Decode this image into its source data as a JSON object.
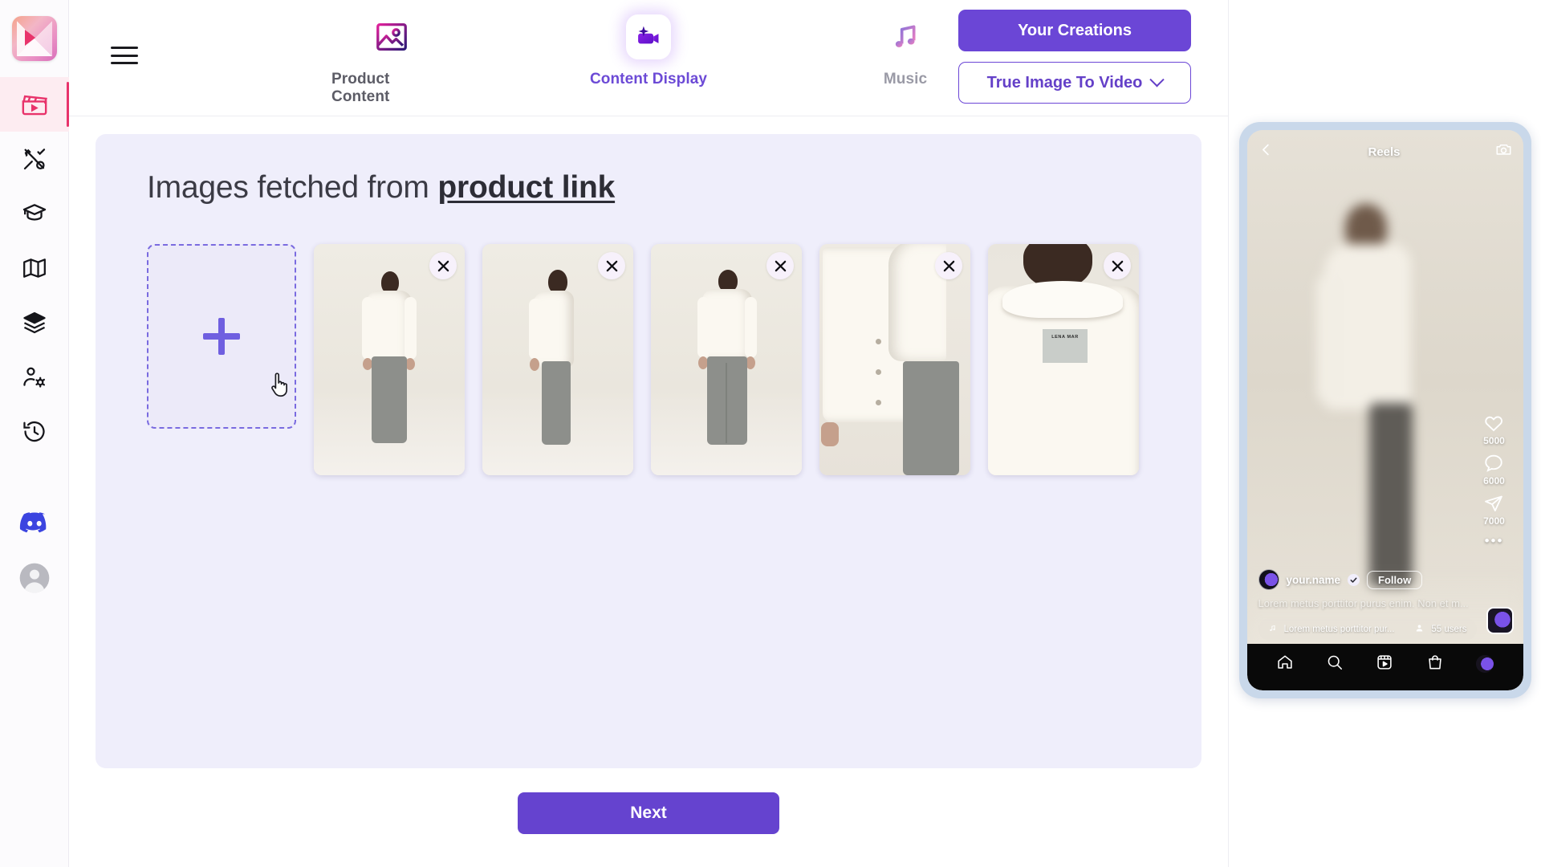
{
  "app": {
    "logo_icon": "app-logo-icon",
    "menu_icon": "hamburger-menu-icon"
  },
  "sidebar": {
    "items": [
      {
        "name": "video-projects",
        "icon": "clapperboard-icon",
        "active": true
      },
      {
        "name": "tools",
        "icon": "tools-icon",
        "active": false
      },
      {
        "name": "learn",
        "icon": "graduation-cap-icon",
        "active": false
      },
      {
        "name": "guide",
        "icon": "map-icon",
        "active": false
      },
      {
        "name": "templates",
        "icon": "layers-icon",
        "active": false
      },
      {
        "name": "team",
        "icon": "user-settings-icon",
        "active": false
      },
      {
        "name": "history",
        "icon": "history-icon",
        "active": false
      },
      {
        "name": "discord",
        "icon": "discord-icon",
        "active": false
      },
      {
        "name": "account",
        "icon": "account-avatar-icon",
        "active": false
      }
    ]
  },
  "header": {
    "tabs": [
      {
        "label": "Product Content",
        "icon": "image-icon",
        "state": "default"
      },
      {
        "label": "Content Display",
        "icon": "sparkle-video-icon",
        "state": "active"
      },
      {
        "label": "Music",
        "icon": "music-note-icon",
        "state": "muted"
      }
    ],
    "creations_button": "Your Creations",
    "mode_select": {
      "value": "True Image To Video",
      "chevron_icon": "chevron-down-icon"
    }
  },
  "main": {
    "title_prefix": "Images fetched from ",
    "title_link": "product link",
    "add_tile": {
      "icon": "plus-icon",
      "label": ""
    },
    "close_icon": "close-icon",
    "thumbnails": [
      {
        "name": "product-image-1",
        "alt": "model front view wearing cream jacket and grey trousers",
        "pose": "front"
      },
      {
        "name": "product-image-2",
        "alt": "model side view wearing cream jacket",
        "pose": "side"
      },
      {
        "name": "product-image-3",
        "alt": "model back view wearing cream jacket",
        "pose": "back"
      },
      {
        "name": "product-image-4",
        "alt": "close up of jacket buttons and sleeve",
        "pose": "detail"
      },
      {
        "name": "product-image-5",
        "alt": "back collar detail with brand label",
        "pose": "label",
        "label_text": "LENA MAR"
      }
    ],
    "next_button": "Next"
  },
  "preview": {
    "platform_title": "Reels",
    "back_icon": "chevron-left-icon",
    "camera_icon": "camera-icon",
    "actions": [
      {
        "icon": "heart-icon",
        "count": "5000"
      },
      {
        "icon": "comment-icon",
        "count": "6000"
      },
      {
        "icon": "share-icon",
        "count": "7000"
      }
    ],
    "more_icon": "more-dots-icon",
    "username": "your.name",
    "verified_icon": "verified-badge-icon",
    "follow_button": "Follow",
    "caption": "Lorem metus porttitor purus enim. Non et m...",
    "music": {
      "icon": "music-note-icon",
      "track": "Lorem metus porttitor pur...",
      "users_icon": "person-icon",
      "users": "55 users"
    },
    "nav": [
      {
        "icon": "home-icon"
      },
      {
        "icon": "search-icon"
      },
      {
        "icon": "reels-icon"
      },
      {
        "icon": "shop-bag-icon"
      },
      {
        "icon": "profile-avatar-icon"
      }
    ]
  },
  "colors": {
    "accent_purple": "#6b46d6",
    "panel_bg": "#efeefb",
    "active_rail": "#e8336b",
    "discord_blue": "#3b44e0"
  }
}
